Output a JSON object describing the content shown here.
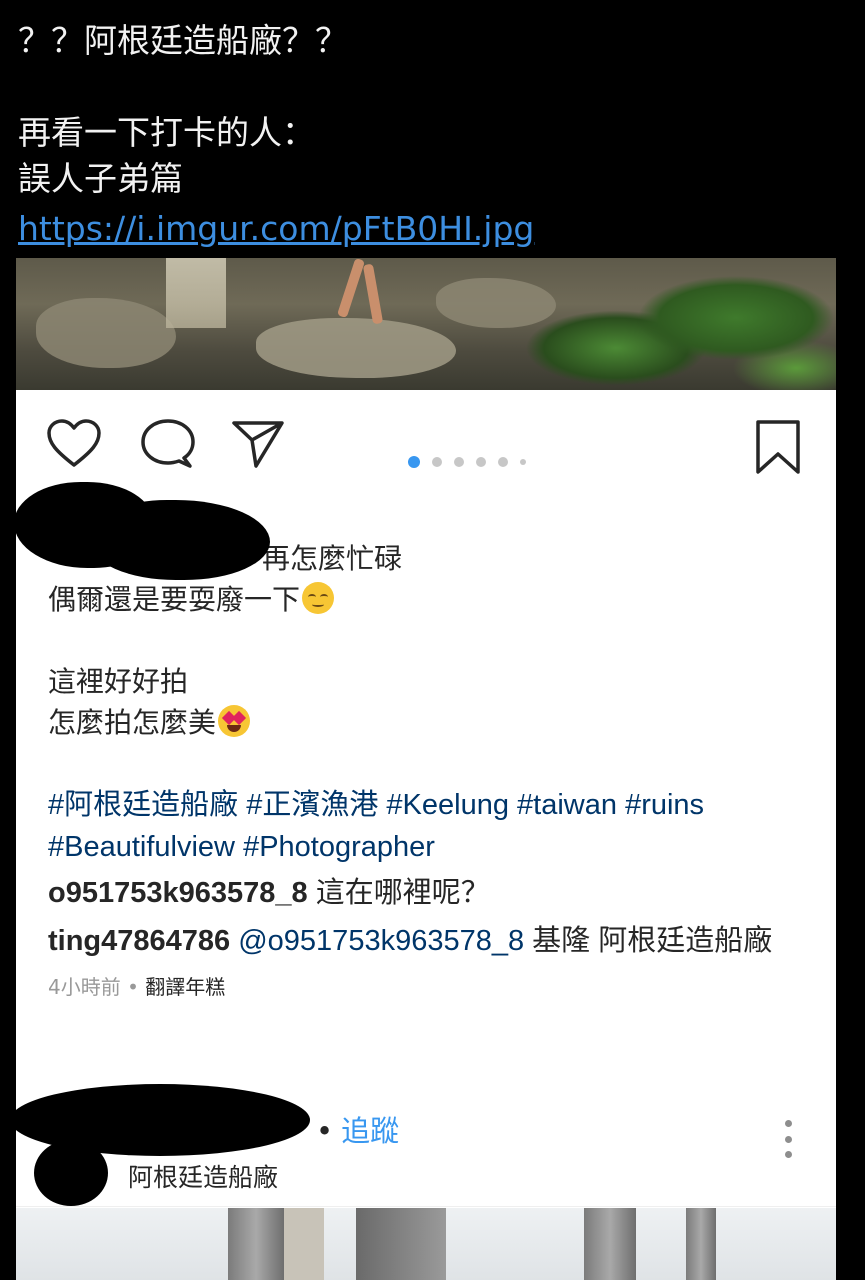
{
  "post": {
    "line1": "？？阿根廷造船廠？？",
    "line2": "再看一下打卡的人：",
    "line3": "誤人子弟篇",
    "link": "https://i.imgur.com/pFtB0HI.jpg"
  },
  "instagram": {
    "carousel": {
      "total": 6,
      "active_index": 0
    },
    "caption": {
      "line1_visible": "再怎麼忙碌",
      "line2": "偶爾還是要耍廢一下",
      "line3": "這裡好好拍",
      "line4": "怎麼拍怎麼美",
      "emoji1": "relieved-face-emoji",
      "emoji2": "heart-eyes-emoji"
    },
    "hashtags": [
      "#阿根廷造船廠",
      "#正濱漁港",
      "#Keelung",
      "#taiwan",
      "#ruins",
      "#Beautifulview",
      "#Photographer"
    ],
    "comments": [
      {
        "user": "o951753k963578_8",
        "text": "這在哪裡呢？"
      },
      {
        "user": "ting47864786",
        "mention": "@o951753k963578_8",
        "text": "基隆 阿根廷造船廠"
      }
    ],
    "meta": {
      "time": "4小時前",
      "separator": "•",
      "translate": "翻譯年糕"
    },
    "next_post": {
      "bullet": "•",
      "follow": "追蹤",
      "location": "阿根廷造船廠"
    }
  }
}
